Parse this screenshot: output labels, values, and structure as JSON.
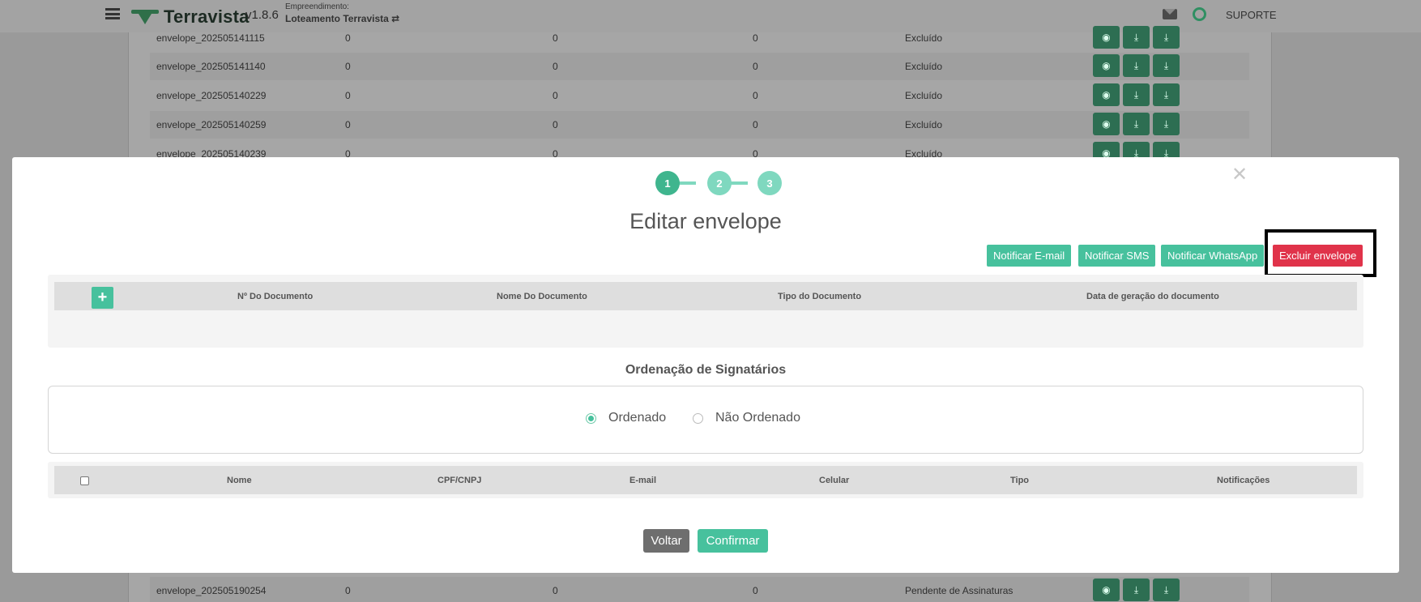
{
  "header": {
    "brand": "Terravista",
    "version": "v1.8.6",
    "project_label": "Empreendimento:",
    "project_name": "Loteamento Terravista ⇄",
    "support": "SUPORTE"
  },
  "background_rows": [
    {
      "name": "envelope_202505141115",
      "a": "0",
      "b": "0",
      "c": "0",
      "status": "Excluído"
    },
    {
      "name": "envelope_202505141140",
      "a": "0",
      "b": "0",
      "c": "0",
      "status": "Excluído"
    },
    {
      "name": "envelope_202505140229",
      "a": "0",
      "b": "0",
      "c": "0",
      "status": "Excluído"
    },
    {
      "name": "envelope_202505140259",
      "a": "0",
      "b": "0",
      "c": "0",
      "status": "Excluído"
    },
    {
      "name": "envelope_202505140239",
      "a": "0",
      "b": "0",
      "c": "0",
      "status": "Excluído"
    },
    {
      "name": "envelope_202505190254",
      "a": "0",
      "b": "0",
      "c": "0",
      "status": "Pendente de Assinaturas"
    }
  ],
  "modal": {
    "steps": [
      "1",
      "2",
      "3"
    ],
    "active_step": 1,
    "title": "Editar envelope",
    "actions": {
      "notify_email": "Notificar E-mail",
      "notify_sms": "Notificar SMS",
      "notify_whatsapp": "Notificar WhatsApp",
      "delete_envelope": "Excluir envelope"
    },
    "documents_table": {
      "add_symbol": "+",
      "columns": [
        "Nº Do Documento",
        "Nome Do Documento",
        "Tipo do Documento",
        "Data de geração do documento"
      ]
    },
    "ordering": {
      "title": "Ordenação de Signatários",
      "options": [
        "Ordenado",
        "Não Ordenado"
      ],
      "selected": "Ordenado"
    },
    "signers_table": {
      "columns": [
        "Nome",
        "CPF/CNPJ",
        "E-mail",
        "Celular",
        "Tipo",
        "Notificações"
      ]
    },
    "footer": {
      "back": "Voltar",
      "confirm": "Confirmar"
    }
  },
  "colors": {
    "accent": "#47c19d",
    "danger": "#e0334a",
    "step_active": "#3fb58e",
    "step_inactive": "#7fd8bf"
  }
}
